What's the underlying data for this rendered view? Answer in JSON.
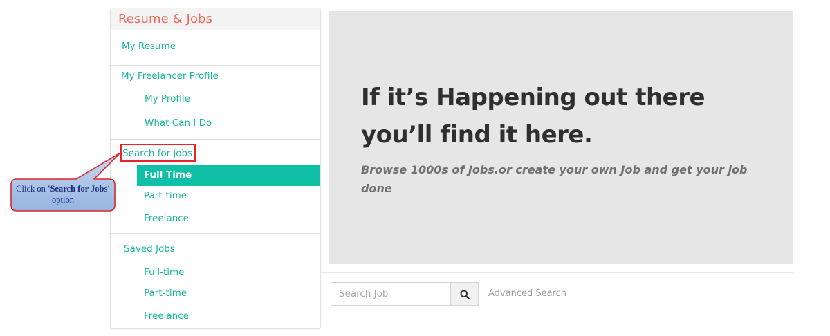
{
  "sidebar": {
    "title": "Resume & Jobs",
    "my_resume": "My Resume",
    "freelancer_profile": "My Freelancer Profile",
    "my_profile": "My Profile",
    "what_can_i_do": "What Can I Do",
    "search_for_jobs": "Search for jobs",
    "search_items": [
      "Full Time",
      "Part-time",
      "Freelance"
    ],
    "saved_jobs": "Saved Jobs",
    "saved_items": [
      "Full-time",
      "Part-time",
      "Freelance"
    ]
  },
  "callout": {
    "prefix": "Click on ",
    "bold": "'Search for Jobs'",
    "suffix": " option"
  },
  "hero": {
    "title_line1": "If it’s Happening out there",
    "title_line2": "you’ll find it here.",
    "subtitle": "Browse 1000s of Jobs.or create your own Job and get your job done"
  },
  "search": {
    "placeholder": "Search Job",
    "advanced": "Advanced Search"
  },
  "colors": {
    "accent": "#0fc0a7",
    "link": "#1ab69a",
    "title": "#f26a5a",
    "highlight": "#e3262a",
    "callout_fill": "#a9c4e8"
  }
}
